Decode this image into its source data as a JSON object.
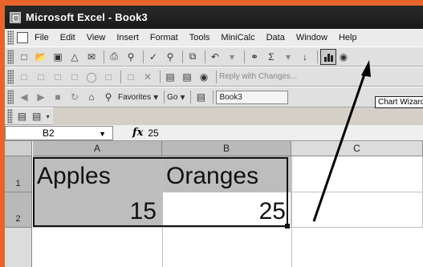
{
  "window": {
    "title": "Microsoft Excel - Book3"
  },
  "menu": [
    "File",
    "Edit",
    "View",
    "Insert",
    "Format",
    "Tools",
    "MiniCalc",
    "Data",
    "Window",
    "Help"
  ],
  "toolbar_web": {
    "favorites": "Favorites",
    "go": "Go",
    "address": "Book3"
  },
  "toolbar_review": {
    "reply": "Reply with Changes..."
  },
  "tooltip": "Chart Wizard",
  "formula_bar": {
    "name_box": "B2",
    "fx": "fx",
    "value": "25"
  },
  "columns": [
    "A",
    "B",
    "C"
  ],
  "rows": [
    "1",
    "2"
  ],
  "cells": {
    "a1": "Apples",
    "b1": "Oranges",
    "a2": "15",
    "b2": "25"
  },
  "selection": {
    "range": "A1:B2",
    "active_cell": "B2"
  }
}
